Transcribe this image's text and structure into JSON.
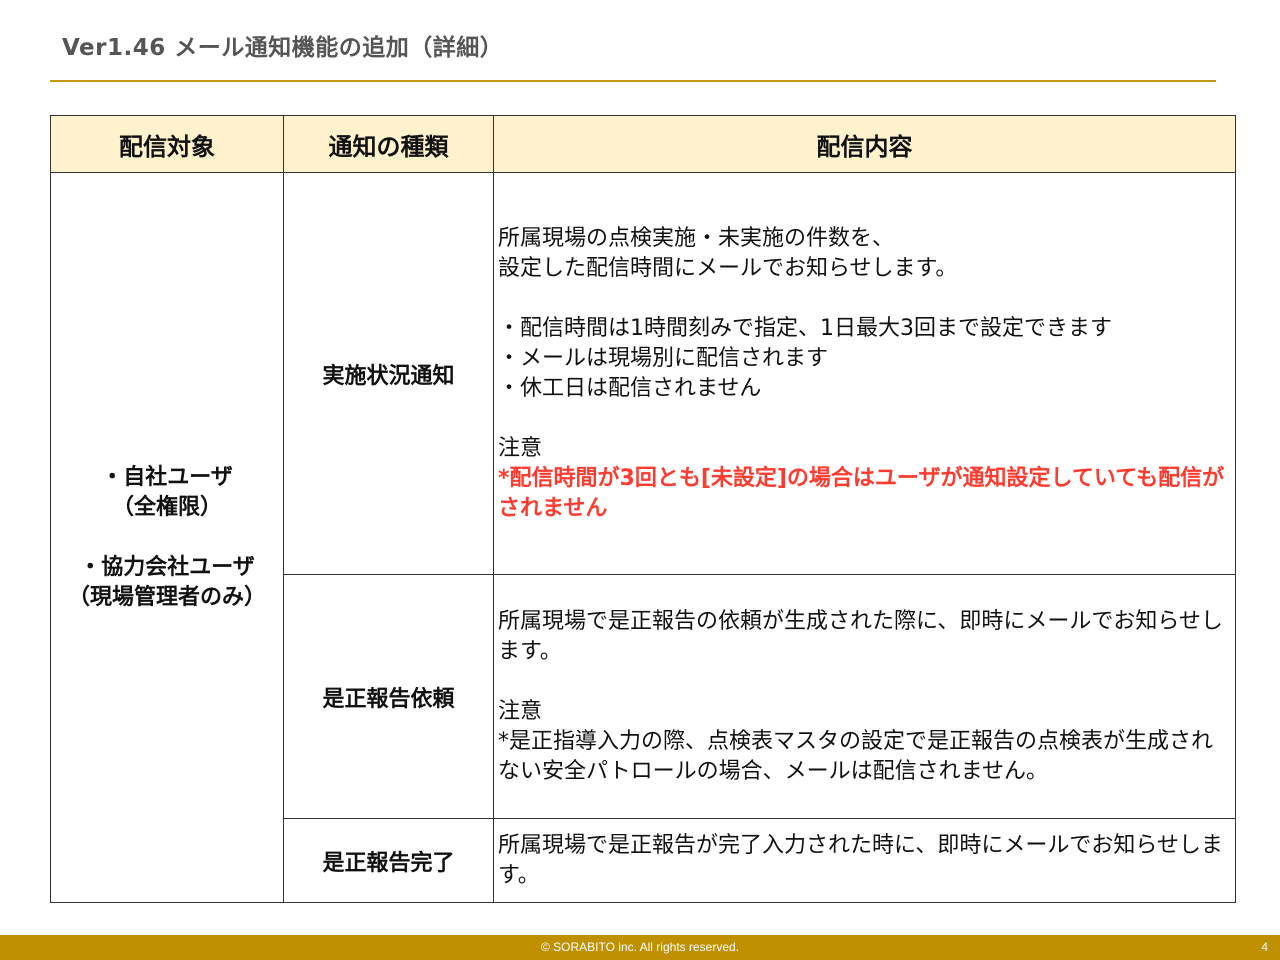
{
  "title": "Ver1.46  メール通知機能の追加（詳細）",
  "table": {
    "headers": [
      "配信対象",
      "通知の種類",
      "配信内容"
    ],
    "target": {
      "line1": "・自社ユーザ",
      "line2": "（全権限）",
      "line3": "・協力会社ユーザ",
      "line4": "（現場管理者のみ）"
    },
    "rows": [
      {
        "type": "実施状況通知",
        "content": {
          "p1": "所属現場の点検実施・未実施の件数を、",
          "p2": "設定した配信時間にメールでお知らせします。",
          "p3": "・配信時間は1時間刻みで指定、1日最大3回まで設定できます",
          "p4": "・メールは現場別に配信されます",
          "p5": "・休工日は配信されません",
          "note_label": "注意",
          "warning": "*配信時間が3回とも[未設定]の場合はユーザが通知設定していても配信がされません"
        }
      },
      {
        "type": "是正報告依頼",
        "content": {
          "p1": "所属現場で是正報告の依頼が生成された際に、即時にメールでお知らせします。",
          "note_label": "注意",
          "p2": "*是正指導入力の際、点検表マスタの設定で是正報告の点検表が生成されない安全パトロールの場合、メールは配信されません。"
        }
      },
      {
        "type": "是正報告完了",
        "content": {
          "p1": "所属現場で是正報告が完了入力された時に、即時にメールでお知らせします。"
        }
      }
    ]
  },
  "footer": {
    "copyright": "© SORABITO inc. All rights reserved.",
    "page_number": "4"
  },
  "colors": {
    "accent": "#bf9000",
    "header_fill": "#fff2cc",
    "warning": "#ff3b30"
  }
}
